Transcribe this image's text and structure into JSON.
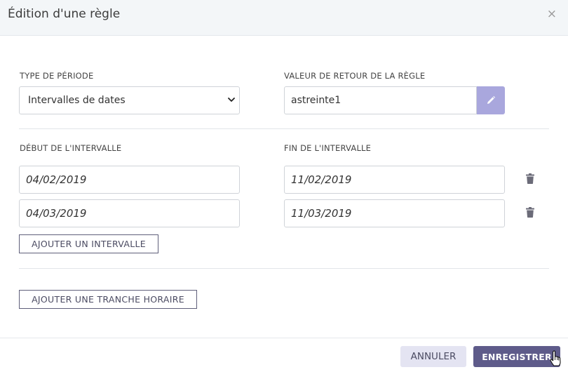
{
  "dialog": {
    "title": "Édition d'une règle",
    "close_glyph": "×"
  },
  "period_type": {
    "label": "TYPE DE PÉRIODE",
    "selected": "Intervalles de dates"
  },
  "return_value": {
    "label": "VALEUR DE RETOUR DE LA RÈGLE",
    "value": "astreinte1"
  },
  "intervals": {
    "start_label": "DÉBUT DE L'INTERVALLE",
    "end_label": "FIN DE L'INTERVALLE",
    "rows": [
      {
        "start": "04/02/2019",
        "end": "11/02/2019"
      },
      {
        "start": "04/03/2019",
        "end": "11/03/2019"
      }
    ],
    "add_label": "AJOUTER UN INTERVALLE"
  },
  "time_slot": {
    "add_label": "AJOUTER UNE TRANCHE HORAIRE"
  },
  "footer": {
    "cancel_label": "ANNULER",
    "save_label": "ENREGISTRER"
  },
  "colors": {
    "accent": "#5e5b8a",
    "edit_button": "#a9a7dd"
  },
  "icons": {
    "close": "close-icon",
    "dropdown": "chevron-down-icon",
    "edit": "pencil-icon",
    "delete": "trash-icon",
    "cursor": "hand-pointer-icon"
  }
}
